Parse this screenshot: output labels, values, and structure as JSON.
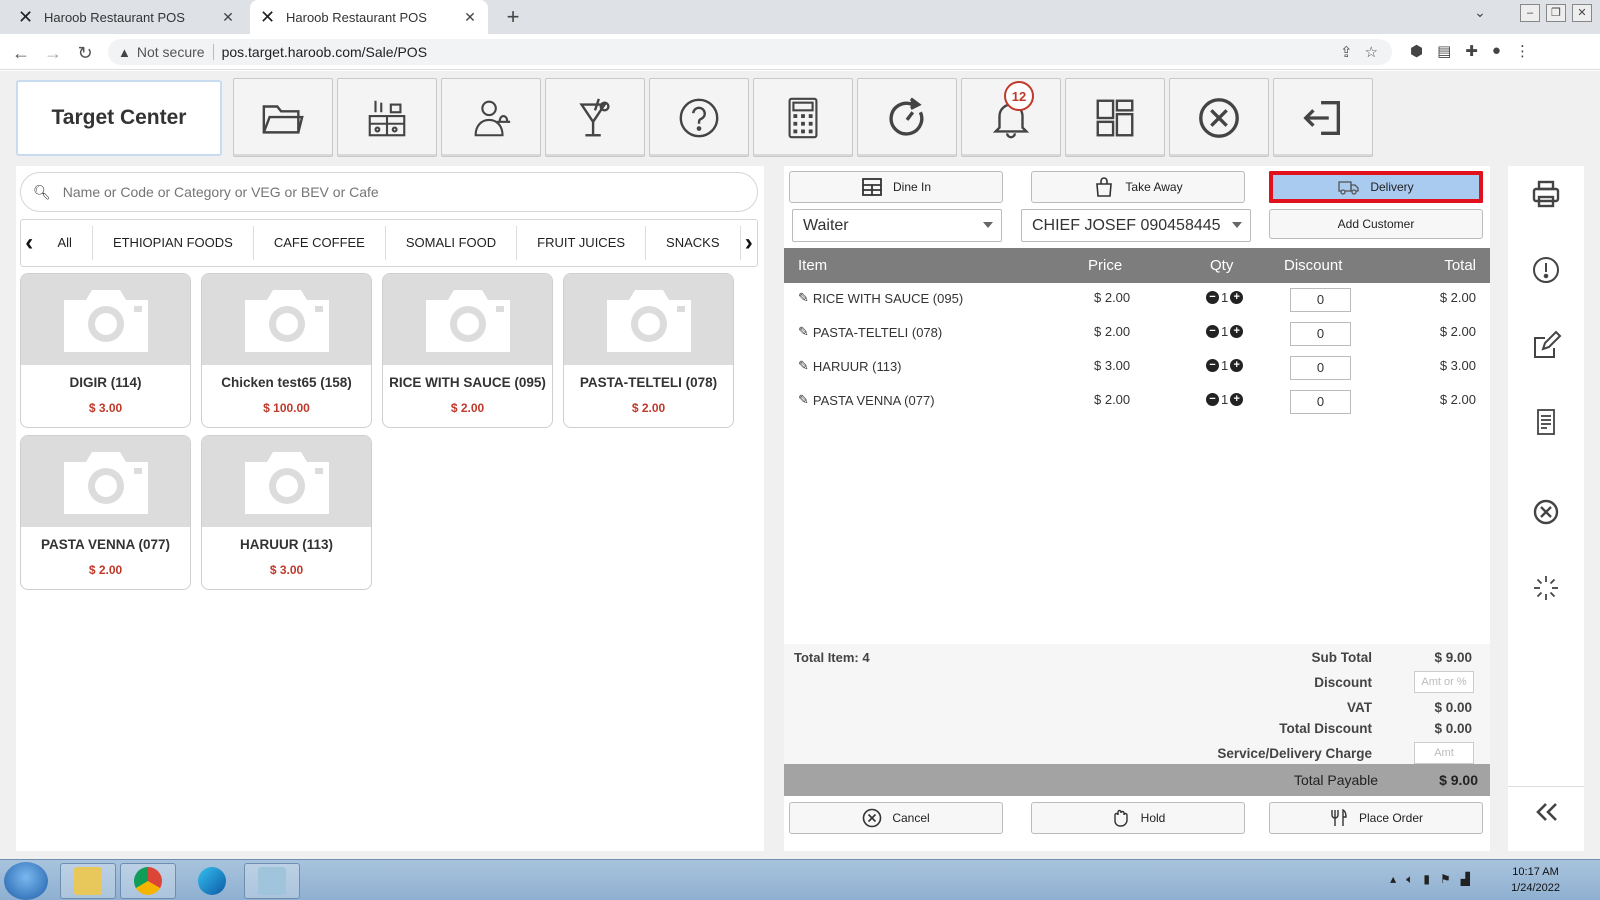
{
  "browser": {
    "tabs": [
      {
        "title": "Haroob Restaurant POS"
      },
      {
        "title": "Haroob Restaurant POS"
      }
    ],
    "new_tab": "+",
    "not_secure": "Not secure",
    "url": "pos.target.haroob.com/Sale/POS"
  },
  "header": {
    "center_name": "Target Center",
    "notification_count": "12",
    "toolbar_icons": [
      "folder-icon",
      "kitchen-icon",
      "waiter-icon",
      "drink-icon",
      "help-icon",
      "calculator-icon",
      "refresh-timer-icon",
      "bell-icon",
      "dashboard-icon",
      "close-circle-icon",
      "logout-icon"
    ]
  },
  "search": {
    "placeholder": "Name or Code or Category or VEG or BEV or Cafe"
  },
  "categories": [
    "All",
    "ETHIOPIAN FOODS",
    "CAFE COFFEE",
    "SOMALI FOOD",
    "FRUIT JUICES",
    "SNACKS"
  ],
  "products": [
    {
      "name": "DIGIR (114)",
      "price": "$ 3.00"
    },
    {
      "name": "Chicken test65 (158)",
      "price": "$ 100.00"
    },
    {
      "name": "RICE WITH SAUCE (095)",
      "price": "$ 2.00"
    },
    {
      "name": "PASTA-TELTELI (078)",
      "price": "$ 2.00"
    },
    {
      "name": "PASTA VENNA (077)",
      "price": "$ 2.00"
    },
    {
      "name": "HARUUR (113)",
      "price": "$ 3.00"
    }
  ],
  "order": {
    "types": {
      "dine_in": "Dine In",
      "take_away": "Take Away",
      "delivery": "Delivery"
    },
    "selected_type": "delivery",
    "waiter": "Waiter",
    "customer": "CHIEF JOSEF 090458445",
    "add_customer": "Add Customer",
    "columns": {
      "item": "Item",
      "price": "Price",
      "qty": "Qty",
      "discount": "Discount",
      "total": "Total"
    },
    "items": [
      {
        "name": "RICE WITH SAUCE (095)",
        "price": "$ 2.00",
        "qty": "1",
        "discount": "0",
        "total": "$ 2.00"
      },
      {
        "name": "PASTA-TELTELI (078)",
        "price": "$ 2.00",
        "qty": "1",
        "discount": "0",
        "total": "$ 2.00"
      },
      {
        "name": "HARUUR (113)",
        "price": "$ 3.00",
        "qty": "1",
        "discount": "0",
        "total": "$ 3.00"
      },
      {
        "name": "PASTA VENNA (077)",
        "price": "$ 2.00",
        "qty": "1",
        "discount": "0",
        "total": "$ 2.00"
      }
    ],
    "total_items": "Total Item: 4",
    "sub_total_label": "Sub Total",
    "sub_total": "$ 9.00",
    "discount_label": "Discount",
    "discount_placeholder": "Amt or %",
    "vat_label": "VAT",
    "vat": "$ 0.00",
    "total_discount_label": "Total Discount",
    "total_discount": "$ 0.00",
    "service_label": "Service/Delivery Charge",
    "service_placeholder": "Amt",
    "payable_label": "Total Payable",
    "payable": "$ 9.00",
    "actions": {
      "cancel": "Cancel",
      "hold": "Hold",
      "place": "Place Order"
    }
  },
  "sidebar_icons": [
    "printer-icon",
    "alert-icon",
    "edit-icon",
    "receipt-icon",
    "close-circle-icon",
    "loading-icon",
    "collapse-icon"
  ],
  "taskbar": {
    "time": "10:17 AM",
    "date": "1/24/2022"
  },
  "colors": {
    "delivery_bg": "#a9cbf0",
    "delivery_border": "#e0101d",
    "price_red": "#c0392b",
    "header_gray": "#7d7d7d"
  }
}
